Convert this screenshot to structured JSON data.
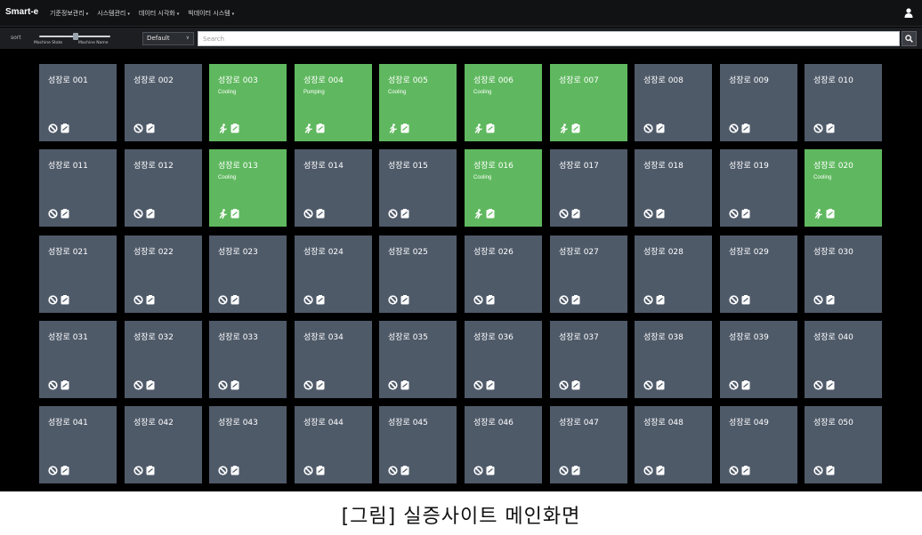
{
  "app": {
    "brand": "Smart-e"
  },
  "nav": {
    "menu": [
      {
        "label": "기준정보관리",
        "caret": "▾"
      },
      {
        "label": "시스템관리",
        "caret": "▾"
      },
      {
        "label": "데이터 시각화",
        "caret": "▾"
      },
      {
        "label": "빅데이터 시스템",
        "caret": "▾"
      }
    ],
    "user_icon": "user-icon"
  },
  "toolbar": {
    "sort_label": "sort",
    "slider_left_caption": "Machine State",
    "slider_right_caption": "Machine Name",
    "sort_select_value": "Default",
    "search_placeholder": "Search",
    "search_icon": "search-icon"
  },
  "colors": {
    "tile_idle": "#4f5a69",
    "tile_active": "#5fb85f",
    "background": "#000000"
  },
  "furnaces": [
    {
      "name": "성장로 001",
      "status": "",
      "active": false
    },
    {
      "name": "성장로 002",
      "status": "",
      "active": false
    },
    {
      "name": "성장로 003",
      "status": "Cooling",
      "active": true
    },
    {
      "name": "성장로 004",
      "status": "Pumping",
      "active": true
    },
    {
      "name": "성장로 005",
      "status": "Cooling",
      "active": true
    },
    {
      "name": "성장로 006",
      "status": "Cooling",
      "active": true
    },
    {
      "name": "성장로 007",
      "status": "",
      "active": true
    },
    {
      "name": "성장로 008",
      "status": "",
      "active": false
    },
    {
      "name": "성장로 009",
      "status": "",
      "active": false
    },
    {
      "name": "성장로 010",
      "status": "",
      "active": false
    },
    {
      "name": "성장로 011",
      "status": "",
      "active": false
    },
    {
      "name": "성장로 012",
      "status": "",
      "active": false
    },
    {
      "name": "성장로 013",
      "status": "Cooling",
      "active": true
    },
    {
      "name": "성장로 014",
      "status": "",
      "active": false
    },
    {
      "name": "성장로 015",
      "status": "",
      "active": false
    },
    {
      "name": "성장로 016",
      "status": "Cooling",
      "active": true
    },
    {
      "name": "성장로 017",
      "status": "",
      "active": false
    },
    {
      "name": "성장로 018",
      "status": "",
      "active": false
    },
    {
      "name": "성장로 019",
      "status": "",
      "active": false
    },
    {
      "name": "성장로 020",
      "status": "Cooling",
      "active": true
    },
    {
      "name": "성장로 021",
      "status": "",
      "active": false
    },
    {
      "name": "성장로 022",
      "status": "",
      "active": false
    },
    {
      "name": "성장로 023",
      "status": "",
      "active": false
    },
    {
      "name": "성장로 024",
      "status": "",
      "active": false
    },
    {
      "name": "성장로 025",
      "status": "",
      "active": false
    },
    {
      "name": "성장로 026",
      "status": "",
      "active": false
    },
    {
      "name": "성장로 027",
      "status": "",
      "active": false
    },
    {
      "name": "성장로 028",
      "status": "",
      "active": false
    },
    {
      "name": "성장로 029",
      "status": "",
      "active": false
    },
    {
      "name": "성장로 030",
      "status": "",
      "active": false
    },
    {
      "name": "성장로 031",
      "status": "",
      "active": false
    },
    {
      "name": "성장로 032",
      "status": "",
      "active": false
    },
    {
      "name": "성장로 033",
      "status": "",
      "active": false
    },
    {
      "name": "성장로 034",
      "status": "",
      "active": false
    },
    {
      "name": "성장로 035",
      "status": "",
      "active": false
    },
    {
      "name": "성장로 036",
      "status": "",
      "active": false
    },
    {
      "name": "성장로 037",
      "status": "",
      "active": false
    },
    {
      "name": "성장로 038",
      "status": "",
      "active": false
    },
    {
      "name": "성장로 039",
      "status": "",
      "active": false
    },
    {
      "name": "성장로 040",
      "status": "",
      "active": false
    },
    {
      "name": "성장로 041",
      "status": "",
      "active": false
    },
    {
      "name": "성장로 042",
      "status": "",
      "active": false
    },
    {
      "name": "성장로 043",
      "status": "",
      "active": false
    },
    {
      "name": "성장로 044",
      "status": "",
      "active": false
    },
    {
      "name": "성장로 045",
      "status": "",
      "active": false
    },
    {
      "name": "성장로 046",
      "status": "",
      "active": false
    },
    {
      "name": "성장로 047",
      "status": "",
      "active": false
    },
    {
      "name": "성장로 048",
      "status": "",
      "active": false
    },
    {
      "name": "성장로 049",
      "status": "",
      "active": false
    },
    {
      "name": "성장로 050",
      "status": "",
      "active": false
    }
  ],
  "caption": "[그림] 실증사이트 메인화면"
}
